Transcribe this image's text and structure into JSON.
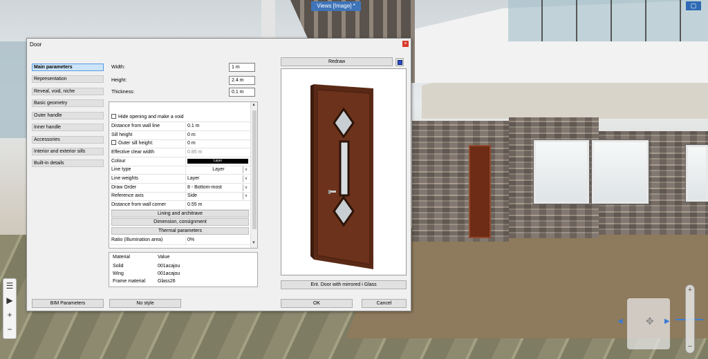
{
  "viewport": {
    "tab_title": "Views [Image] *"
  },
  "dialog": {
    "title": "Door",
    "close_glyph": "×",
    "nav_items": [
      "Main parameters",
      "Representation",
      "Reveal, void, niche",
      "Basic geometry",
      "Outer handle",
      "Inner handle",
      "Accessories",
      "Interior and exterior sills",
      "Built-in details"
    ],
    "active_nav_index": 0,
    "fields": {
      "width_label": "Width:",
      "width_value": "1 m",
      "height_label": "Height:",
      "height_value": "2.4 m",
      "thickness_label": "Thickness:",
      "thickness_value": "0.1 m"
    },
    "params": {
      "hide_opening": "Hide opening and make a void",
      "distance_wall_line_label": "Distance from wall line",
      "distance_wall_line_value": "0.1 m",
      "sill_height_label": "Sill height",
      "sill_height_value": "0 m",
      "outer_sill_label": "Outer sill height:",
      "outer_sill_value": "0 m",
      "clear_width_label": "Effective clear width",
      "clear_width_value": "0.85 m",
      "colour_label": "Colour",
      "colour_value": "Layer",
      "line_type_label": "Line type",
      "line_type_value": "Layer",
      "line_weights_label": "Line weights",
      "line_weights_value": "Layer",
      "draw_order_label": "Draw Order",
      "draw_order_value": "8 - Bottom-most",
      "ref_axis_label": "Reference axis",
      "ref_axis_value": "Side",
      "distance_corner_label": "Distance from wall corner",
      "distance_corner_value": "0.55 m",
      "section_lining": "Lining and architrave",
      "section_dimension": "Dimension, consignment",
      "section_thermal": "Thermal parameters",
      "ratio_label": "Ratio (Illumination area)",
      "ratio_value": "0%"
    },
    "material": {
      "col_material": "Material",
      "col_value": "Value",
      "rows": [
        {
          "k": "Solid",
          "v": "001acajou"
        },
        {
          "k": "Wing",
          "v": "001acajou"
        },
        {
          "k": "Frame material",
          "v": "Glass26"
        }
      ]
    },
    "buttons": {
      "redraw": "Redraw",
      "door_name": "Ent. Door with mirrored i Glass",
      "bim": "BIM Parameters",
      "style": "No style",
      "ok": "OK",
      "cancel": "Cancel"
    },
    "icons": {
      "dropdown": "∨",
      "scroll_up": "▲",
      "scroll_down": "▼"
    }
  },
  "toolbar": {
    "icons": [
      "list-icon",
      "play-icon",
      "plus-icon",
      "minus-icon"
    ],
    "glyphs": [
      "☰",
      "▶",
      "+",
      "−"
    ]
  },
  "navigation": {
    "zoom_in": "+",
    "zoom_out": "−"
  }
}
